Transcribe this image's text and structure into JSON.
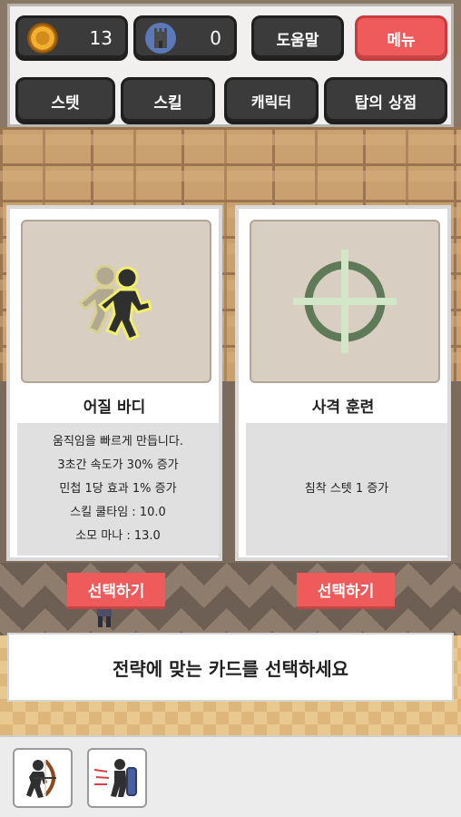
{
  "hud": {
    "coins": {
      "icon": "coin-icon",
      "value": "13"
    },
    "towers": {
      "icon": "tower-icon",
      "value": "0"
    },
    "help_label": "도움말",
    "menu_label": "메뉴",
    "stats_label": "스텟",
    "skills_label": "스킬",
    "character_label": "캐릭터",
    "shop_label": "탑의 상점"
  },
  "cards": [
    {
      "title": "어질 바디",
      "icon": "running-figure-icon",
      "desc": [
        "움직임을 빠르게 만듭니다.",
        "3초간 속도가 30% 증가",
        "민첩 1당 효과 1% 증가",
        "스킬 쿨타임 : 10.0",
        "소모 마나 : 13.0"
      ],
      "select_label": "선택하기"
    },
    {
      "title": "사격 훈련",
      "icon": "crosshair-icon",
      "desc": [
        "침착 스텟 1 증가"
      ],
      "select_label": "선택하기"
    }
  ],
  "prompt": "전략에 맞는 카드를 선택하세요",
  "skills": [
    {
      "icon": "archer-skill-icon"
    },
    {
      "icon": "dash-shield-skill-icon"
    }
  ],
  "colors": {
    "accent_red": "#ef5a5a",
    "button_dark": "#3b3b3b",
    "crosshair_green": "#5f7a58"
  }
}
